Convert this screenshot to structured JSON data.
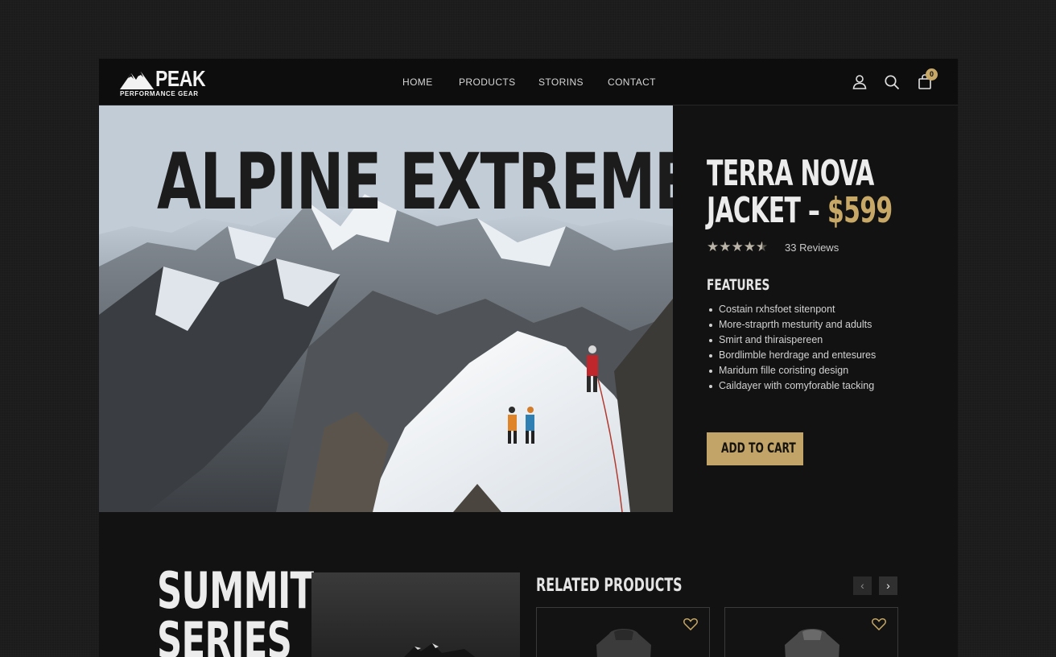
{
  "brand": {
    "name": "PEAK",
    "tagline": "PERFORMANCE GEAR",
    "logo_icon": "mountain-icon"
  },
  "nav": {
    "items": [
      "HOME",
      "PRODUCTS",
      "STORINS",
      "CONTACT"
    ]
  },
  "header_icons": {
    "account": "user-icon",
    "search": "search-icon",
    "cart": "shopping-bag-icon",
    "cart_count": "0"
  },
  "hero": {
    "title": "ALPINE EXTREME"
  },
  "product": {
    "title_line1": "TERRA NOVA",
    "title_line2": "JACKET –",
    "price": "$599",
    "rating": 4.5,
    "stars_max": 5,
    "reviews": "33 Reviews",
    "features_heading": "FEATURES",
    "features": [
      "Costain rxhsfoet sitenpont",
      "More-straprth mesturity and adults",
      "Smirt and thiraispereen",
      "Bordlimble herdrage and entesures",
      "Maridum fille coristing design",
      "Caildayer with comyforable tacking"
    ],
    "cta": "ADD TO CART"
  },
  "series": {
    "title": "SUMMIT\nSERIES"
  },
  "related": {
    "heading": "RELATED PRODUCTS",
    "prev_icon": "chevron-left-icon",
    "next_icon": "chevron-right-icon"
  },
  "colors": {
    "accent": "#c7a866",
    "background": "#121212",
    "text": "#ececec"
  }
}
